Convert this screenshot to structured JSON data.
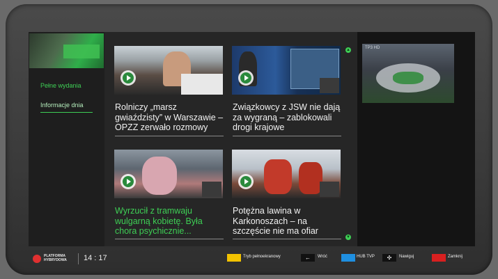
{
  "sidebar": {
    "items": [
      {
        "label": "Pełne wydania"
      },
      {
        "label": "Informacje dnia"
      }
    ]
  },
  "tiles": [
    {
      "title": "Rolniczy „marsz gwiaździsty” w Warszawie – OPZZ zerwało rozmowy",
      "color": "#f2f2f2"
    },
    {
      "title": "Związkowcy z JSW nie dają za wygraną – zablokowali drogi krajowe",
      "color": "#f2f2f2"
    },
    {
      "title": "Wyrzucił z tramwaju wulgarną kobietę. Była chora psychicznie...",
      "color": "#3ecf55"
    },
    {
      "title": "Potężna lawina w Karkonoszach – na szczęście nie ma ofiar",
      "color": "#f2f2f2"
    }
  ],
  "preview": {
    "channel_label": "TP3 HD"
  },
  "bottom_bar": {
    "brand_line1": "PLATFORMA",
    "brand_line2": "HYBRYDOWA",
    "clock": "14 : 17",
    "keys": [
      {
        "color": "#f2c200",
        "label": "Tryb pełnoekranowy"
      },
      {
        "icon": "arrow-left-icon",
        "glyph": "←",
        "label": "Wróć"
      },
      {
        "color": "#1f8fe0",
        "label": "HUB TVP"
      },
      {
        "icon": "navigate-icon",
        "glyph": "✣",
        "label": "Nawiguj"
      },
      {
        "color": "#d82020",
        "label": "Zamknij"
      }
    ]
  },
  "colors": {
    "accent": "#3ecf55",
    "brand": "#e03030"
  }
}
